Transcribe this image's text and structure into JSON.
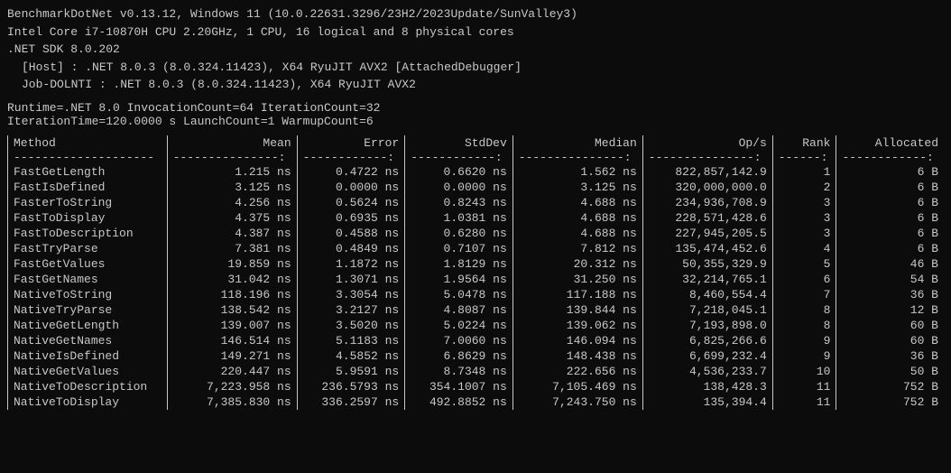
{
  "header": {
    "line1": "BenchmarkDotNet v0.13.12, Windows 11 (10.0.22631.3296/23H2/2023Update/SunValley3)",
    "line2": "Intel Core i7-10870H CPU 2.20GHz, 1 CPU, 16 logical and 8 physical cores",
    "line3": ".NET SDK 8.0.202",
    "line4": "[Host]    : .NET 8.0.3 (8.0.324.11423), X64 RyuJIT AVX2 [AttachedDebugger]",
    "line5": "Job-DOLNTI : .NET 8.0.3 (8.0.324.11423), X64 RyuJIT AVX2",
    "runtime1": "Runtime=.NET 8.0  InvocationCount=64  IterationCount=32",
    "runtime2": "IterationTime=120.0000 s  LaunchCount=1  WarmupCount=6"
  },
  "table": {
    "columns": [
      "Method",
      "Mean",
      "Error",
      "StdDev",
      "Median",
      "Op/s",
      "Rank",
      "Allocated"
    ],
    "separator": [
      "--------------------",
      "---------------:",
      "------------:",
      "------------:",
      "---------------:",
      "---------------:",
      "------:",
      "------------:"
    ],
    "rows": [
      [
        "FastGetLength",
        "1.215 ns",
        "0.4722 ns",
        "0.6620 ns",
        "1.562 ns",
        "822,857,142.9",
        "1",
        "6 B"
      ],
      [
        "FastIsDefined",
        "3.125 ns",
        "0.0000 ns",
        "0.0000 ns",
        "3.125 ns",
        "320,000,000.0",
        "2",
        "6 B"
      ],
      [
        "FasterToString",
        "4.256 ns",
        "0.5624 ns",
        "0.8243 ns",
        "4.688 ns",
        "234,936,708.9",
        "3",
        "6 B"
      ],
      [
        "FastToDisplay",
        "4.375 ns",
        "0.6935 ns",
        "1.0381 ns",
        "4.688 ns",
        "228,571,428.6",
        "3",
        "6 B"
      ],
      [
        "FastToDescription",
        "4.387 ns",
        "0.4588 ns",
        "0.6280 ns",
        "4.688 ns",
        "227,945,205.5",
        "3",
        "6 B"
      ],
      [
        "FastTryParse",
        "7.381 ns",
        "0.4849 ns",
        "0.7107 ns",
        "7.812 ns",
        "135,474,452.6",
        "4",
        "6 B"
      ],
      [
        "FastGetValues",
        "19.859 ns",
        "1.1872 ns",
        "1.8129 ns",
        "20.312 ns",
        "50,355,329.9",
        "5",
        "46 B"
      ],
      [
        "FastGetNames",
        "31.042 ns",
        "1.3071 ns",
        "1.9564 ns",
        "31.250 ns",
        "32,214,765.1",
        "6",
        "54 B"
      ],
      [
        "NativeToString",
        "118.196 ns",
        "3.3054 ns",
        "5.0478 ns",
        "117.188 ns",
        "8,460,554.4",
        "7",
        "36 B"
      ],
      [
        "NativeTryParse",
        "138.542 ns",
        "3.2127 ns",
        "4.8087 ns",
        "139.844 ns",
        "7,218,045.1",
        "8",
        "12 B"
      ],
      [
        "NativeGetLength",
        "139.007 ns",
        "3.5020 ns",
        "5.0224 ns",
        "139.062 ns",
        "7,193,898.0",
        "8",
        "60 B"
      ],
      [
        "NativeGetNames",
        "146.514 ns",
        "5.1183 ns",
        "7.0060 ns",
        "146.094 ns",
        "6,825,266.6",
        "9",
        "60 B"
      ],
      [
        "NativeIsDefined",
        "149.271 ns",
        "4.5852 ns",
        "6.8629 ns",
        "148.438 ns",
        "6,699,232.4",
        "9",
        "36 B"
      ],
      [
        "NativeGetValues",
        "220.447 ns",
        "5.9591 ns",
        "8.7348 ns",
        "222.656 ns",
        "4,536,233.7",
        "10",
        "50 B"
      ],
      [
        "NativeToDescription",
        "7,223.958 ns",
        "236.5793 ns",
        "354.1007 ns",
        "7,105.469 ns",
        "138,428.3",
        "11",
        "752 B"
      ],
      [
        "NativeToDisplay",
        "7,385.830 ns",
        "336.2597 ns",
        "492.8852 ns",
        "7,243.750 ns",
        "135,394.4",
        "11",
        "752 B"
      ]
    ]
  }
}
